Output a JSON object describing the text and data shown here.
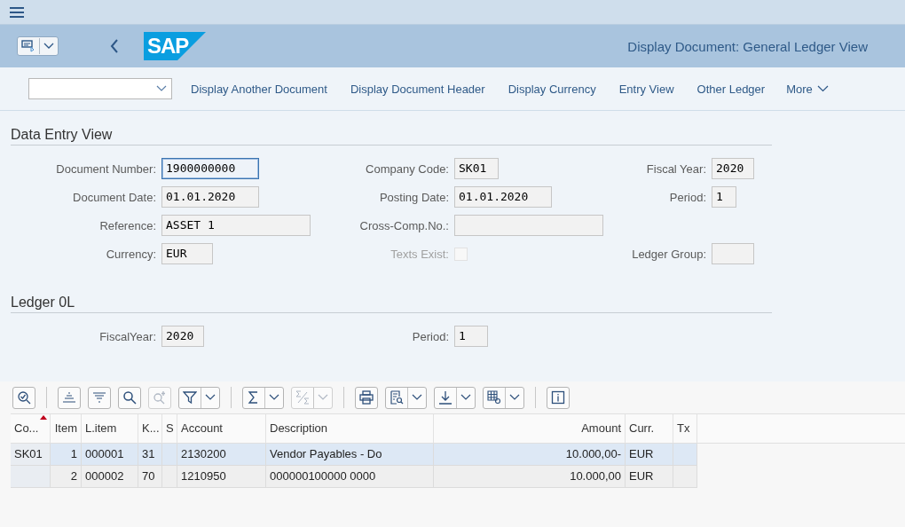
{
  "header": {
    "title": "Display Document: General Ledger View",
    "logo": "SAP"
  },
  "toolbar": {
    "links": [
      "Display Another Document",
      "Display Document Header",
      "Display Currency",
      "Entry View",
      "Other Ledger"
    ],
    "more": "More"
  },
  "data_entry_view": {
    "title": "Data Entry View",
    "rows": [
      [
        {
          "kind": "input",
          "label": "Document Number:",
          "value": "1900000000",
          "focused": true
        },
        {
          "kind": "input",
          "label": "Company Code:",
          "value": "SK01",
          "focused": false
        },
        {
          "kind": "input",
          "label": "Fiscal Year:",
          "value": "2020",
          "focused": false
        }
      ],
      [
        {
          "kind": "input",
          "label": "Document Date:",
          "value": "01.01.2020",
          "focused": false
        },
        {
          "kind": "input",
          "label": "Posting Date:",
          "value": "01.01.2020",
          "focused": false
        },
        {
          "kind": "input",
          "label": "Period:",
          "value": "1",
          "focused": false
        }
      ],
      [
        {
          "kind": "input",
          "label": "Reference:",
          "value": "ASSET 1",
          "focused": false
        },
        {
          "kind": "input",
          "label": "Cross-Comp.No.:",
          "focused": false
        }
      ],
      [
        {
          "kind": "input",
          "label": "Currency:",
          "value": "EUR",
          "focused": false
        },
        {
          "kind": "checkbox",
          "label": "Texts Exist:",
          "checked": false,
          "disabled": true
        },
        {
          "kind": "input",
          "label": "Ledger Group:",
          "focused": false
        }
      ]
    ]
  },
  "ledger": {
    "title": "Ledger 0L",
    "rows": [
      [
        {
          "kind": "input",
          "label": "FiscalYear:",
          "value": "2020",
          "focused": false
        },
        {
          "kind": "input",
          "label": "Period:",
          "value": "1",
          "focused": false
        }
      ]
    ]
  },
  "table_toolbar": [
    {
      "kind": "details",
      "disabled": false
    },
    {
      "kind": "sep"
    },
    {
      "kind": "sort-asc",
      "disabled": false
    },
    {
      "kind": "sort-desc",
      "disabled": false
    },
    {
      "kind": "find",
      "disabled": false
    },
    {
      "kind": "find-next",
      "disabled": true
    },
    {
      "kind": "filter",
      "disabled": false
    },
    {
      "kind": "sep"
    },
    {
      "kind": "sum",
      "disabled": false
    },
    {
      "kind": "subtotal",
      "disabled": true
    },
    {
      "kind": "sep"
    },
    {
      "kind": "print",
      "disabled": false
    },
    {
      "kind": "view",
      "disabled": false
    },
    {
      "kind": "export",
      "disabled": false
    },
    {
      "kind": "layout",
      "disabled": false
    },
    {
      "kind": "sep"
    },
    {
      "kind": "info",
      "disabled": false
    }
  ],
  "table": {
    "columns": [
      {
        "label": "Co...",
        "sorted": true
      },
      {
        "label": "Item",
        "sorted": false
      },
      {
        "label": "L.item",
        "sorted": false
      },
      {
        "label": "K...",
        "sorted": false
      },
      {
        "label": "S",
        "sorted": false
      },
      {
        "label": "Account",
        "sorted": false
      },
      {
        "label": "Description",
        "sorted": false
      },
      {
        "label": "Amount",
        "sorted": false
      },
      {
        "label": "Curr.",
        "sorted": false
      },
      {
        "label": "Tx",
        "sorted": false
      }
    ],
    "rows": [
      {
        "selected": true,
        "cells": [
          "SK01",
          "1",
          "000001",
          "31",
          "",
          "2130200",
          "Vendor Payables - Do",
          "10.000,00-",
          "EUR",
          ""
        ]
      },
      {
        "selected": false,
        "cells": [
          "",
          "2",
          "000002",
          "70",
          "",
          "1210950",
          "000000100000 0000",
          "10.000,00",
          "EUR",
          ""
        ]
      }
    ]
  }
}
